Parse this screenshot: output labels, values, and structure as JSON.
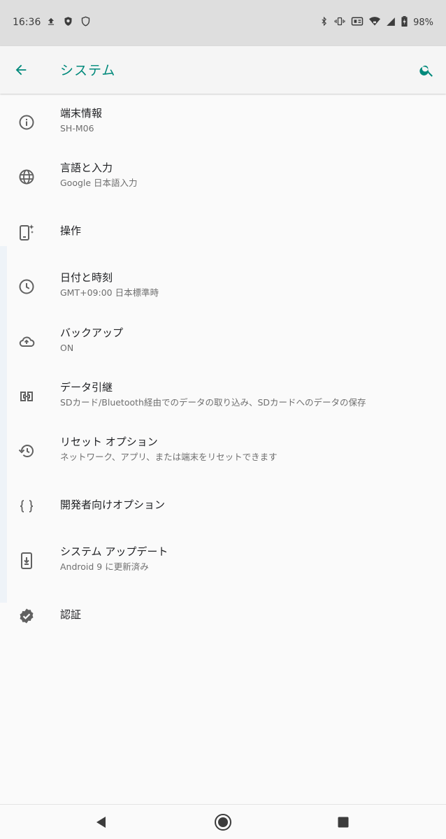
{
  "status_bar": {
    "time": "16:36",
    "left_icons": [
      "upload-icon",
      "shield-badge-icon",
      "shield-outline-icon"
    ],
    "right_icons": [
      "bluetooth-icon",
      "vibrate-icon",
      "nfc-icon",
      "wifi-icon",
      "cell-signal-icon",
      "battery-icon"
    ],
    "battery_text": "98%"
  },
  "app_bar": {
    "title": "システム",
    "accent_color": "#00897b"
  },
  "settings_items": [
    {
      "title": "端末情報",
      "subtitle": "SH-M06",
      "icon": "info-icon"
    },
    {
      "title": "言語と入力",
      "subtitle": "Google 日本語入力",
      "icon": "globe-icon"
    },
    {
      "title": "操作",
      "subtitle": "",
      "icon": "phone-sparkle-icon"
    },
    {
      "title": "日付と時刻",
      "subtitle": "GMT+09:00 日本標準時",
      "icon": "clock-icon"
    },
    {
      "title": "バックアップ",
      "subtitle": "ON",
      "icon": "cloud-upload-icon"
    },
    {
      "title": "データ引継",
      "subtitle": "SDカード/Bluetooth経由でのデータの取り込み、SDカードへのデータの保存",
      "icon": "data-transfer-icon"
    },
    {
      "title": "リセット オプション",
      "subtitle": "ネットワーク、アプリ、または端末をリセットできます",
      "icon": "history-icon"
    },
    {
      "title": "開発者向けオプション",
      "subtitle": "",
      "icon": "braces-icon"
    },
    {
      "title": "システム アップデート",
      "subtitle": "Android 9 に更新済み",
      "icon": "system-update-icon"
    },
    {
      "title": "認証",
      "subtitle": "",
      "icon": "verified-badge-icon"
    }
  ],
  "nav_bar": {
    "buttons": [
      "back-triangle-icon",
      "home-circle-icon",
      "recents-square-icon"
    ]
  }
}
